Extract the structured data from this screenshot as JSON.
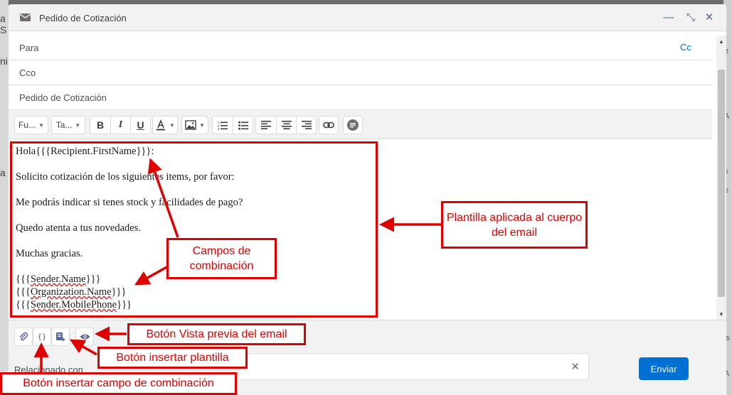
{
  "background": {
    "left_fragments": [
      "a S",
      "ni",
      "a"
    ],
    "right_fragments": [
      "e",
      "A",
      "s",
      "e",
      "is",
      "A"
    ]
  },
  "window": {
    "title": "Pedido de Cotización",
    "controls": {
      "minimize": "—",
      "expand": "⤡",
      "close": "✕"
    }
  },
  "fields": {
    "to_label": "Para",
    "cc_label": "Cc",
    "bcc_label": "Cco",
    "subject": "Pedido de Cotización"
  },
  "toolbar": {
    "font_label": "Fu...",
    "size_label": "Ta..."
  },
  "body": {
    "greeting": "Hola",
    "greeting_field": "{{{Recipient.FirstName}}}",
    "greeting_suffix": ":",
    "line1": "Solicito cotización de los siguientes items, por favor:",
    "line2": "Me podrás indicar si tenes stock y facilidades de pago?",
    "line3": "Quedo atenta a tus novedades.",
    "line4": "Muchas gracias.",
    "sig_name_open": "{{{",
    "sig_name": "Sender.Name",
    "sig_name_close": "}}}",
    "sig_org_open": "{{{",
    "sig_org": "Organization.Name",
    "sig_org_close": "}}}",
    "sig_phone_open": "{{{",
    "sig_phone": "Sender.MobilePhone",
    "sig_phone_close": "}}}"
  },
  "bottom": {
    "merge_button_label": "{ }",
    "related_label": "Relacionado con",
    "send_label": "Enviar"
  },
  "annotations": {
    "template_applied": "Plantilla aplicada al cuerpo del email",
    "merge_fields": "Campos de combinación",
    "preview_button": "Botón Vista previa del email",
    "insert_template": "Botón insertar plantilla",
    "insert_merge_field": "Botón insertar campo de combinación"
  },
  "colors": {
    "annotation_red": "#e00000",
    "send_blue": "#0070d2",
    "link_blue": "#0070d2",
    "header_gray": "#f3f2f2"
  }
}
